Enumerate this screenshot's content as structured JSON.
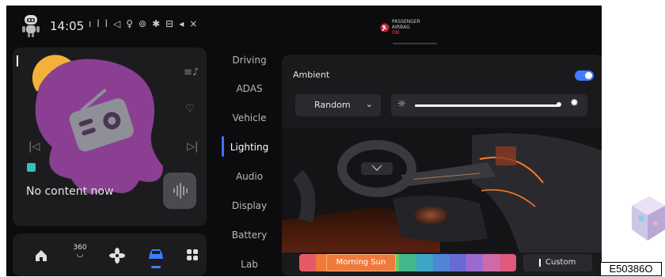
{
  "status_bar": {
    "time": "14:05",
    "icons": [
      "signal-icon",
      "location-icon",
      "mic-icon",
      "hotspot-icon",
      "bluetooth-icon",
      "lock-icon",
      "mute-icon"
    ],
    "airbag_line1": "PASSENGER",
    "airbag_line2_prefix": "AIRBAG",
    "airbag_line2_status": "ON"
  },
  "media": {
    "empty_text": "No content now",
    "icons": [
      "radio-icon",
      "playlist-icon",
      "heart-icon",
      "previous-icon",
      "next-icon",
      "source-icon",
      "voice-icon"
    ]
  },
  "bottom_nav": {
    "items": [
      "home",
      "360",
      "fan",
      "car",
      "apps"
    ],
    "label_360": "360"
  },
  "menu": {
    "items": [
      "Driving",
      "ADAS",
      "Vehicle",
      "Lighting",
      "Audio",
      "Display",
      "Battery",
      "Lab"
    ],
    "active": "Lighting"
  },
  "ambient": {
    "label": "Ambient",
    "enabled": true,
    "mode": "Random",
    "brightness": 0.96,
    "color_theme": "Morning Sun",
    "custom_label": "Custom",
    "accent": "#3f7cff"
  },
  "figure_code": "E50386O"
}
